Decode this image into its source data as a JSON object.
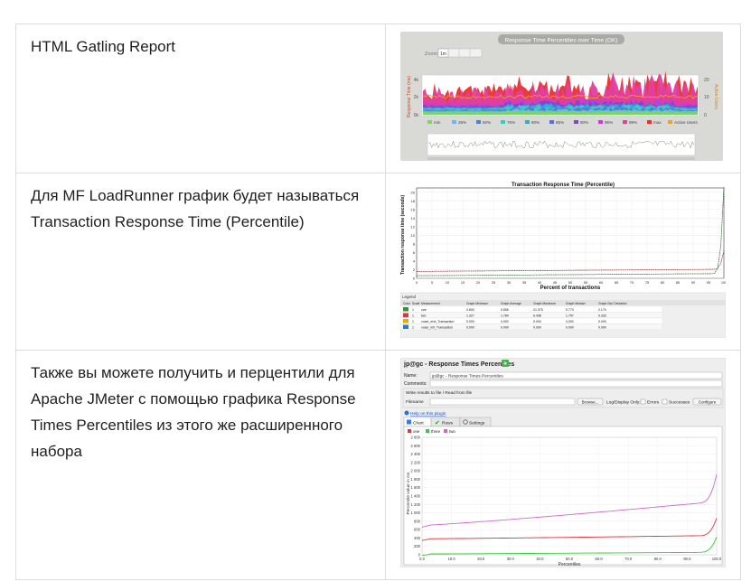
{
  "rows": [
    {
      "text": "HTML Gatling Report",
      "figure": {
        "title": "Response Time Percentiles over Time (OK)",
        "zoom_label": "Zoom",
        "zoom_options": [
          "1m"
        ],
        "y_left_label": "Response Time (ms)",
        "y_right_label": "Active Users",
        "y_left_ticks": [
          "4k",
          "2k",
          "0k"
        ],
        "y_right_ticks": [
          "20",
          "10",
          "0"
        ],
        "legend": [
          "min",
          "25%",
          "50%",
          "75%",
          "80%",
          "85%",
          "90%",
          "95%",
          "99%",
          "max",
          "Active Users"
        ],
        "colors": [
          "#7cd65e",
          "#6fb8e8",
          "#4f7fd1",
          "#3dc9c2",
          "#2ab0d8",
          "#5f6bd6",
          "#8a3fd1",
          "#c23fd0",
          "#e03fa0",
          "#e8322f",
          "#f2a31b"
        ]
      }
    },
    {
      "text": "Для MF LoadRunner график будет называться Transaction Response Time (Percentile)",
      "figure": {
        "title": "Transaction Response Time (Percentile)",
        "ylabel": "Transaction response time (seconds)",
        "xlabel": "Percent of transactions",
        "legend_title": "Legend",
        "legend_headers": [
          "Color",
          "Scale",
          "Measurement",
          "Graph Minimum",
          "Graph Average",
          "Graph Maximum",
          "Graph Median",
          "Graph Std. Deviation"
        ],
        "legend_rows": [
          {
            "color": "#3b8e3b",
            "scale": "1",
            "measurement": "one",
            "min": "0.800",
            "avg": "0.856",
            "max": "21.375",
            "median": "0.773",
            "std": "2.170"
          },
          {
            "color": "#d9363e",
            "scale": "1",
            "measurement": "two",
            "min": "1.327",
            "avg": "1.784",
            "max": "6.438",
            "median": "1.757",
            "std": "0.333"
          },
          {
            "color": "#e0b000",
            "scale": "1",
            "measurement": "vuser_end_Transaction",
            "min": "0.000",
            "avg": "0.000",
            "max": "0.000",
            "median": "0.000",
            "std": "0.000"
          },
          {
            "color": "#2a7bbf",
            "scale": "1",
            "measurement": "vuser_init_Transaction",
            "min": "0.000",
            "avg": "0.000",
            "max": "0.000",
            "median": "0.000",
            "std": "0.000"
          }
        ]
      }
    },
    {
      "text": "Также вы можете получить и перцентили для Apache JMeter с помощью графика Response Times Percentiles из этого же расширенного набора",
      "figure": {
        "window_title": "jp@gc - Response Times Percentiles",
        "name_label": "Name:",
        "name_value": "jp@gc - Response Times Percentiles",
        "comments_label": "Comments:",
        "write_label": "Write results to file / Read from file",
        "filename_label": "Filename",
        "browse_label": "Browse...",
        "log_label": "Log/Display Only:",
        "errors_label": "Errors",
        "successes_label": "Successes",
        "configure_label": "Configure",
        "help_label": "Help on this plugin",
        "tabs": [
          "Chart",
          "Rows",
          "Settings"
        ],
        "series": [
          {
            "name": "one",
            "color": "#d9363e"
          },
          {
            "name": "three",
            "color": "#3cc83c"
          },
          {
            "name": "two",
            "color": "#d066c8"
          }
        ],
        "y_ticks": [
          "2 800",
          "2 600",
          "2 400",
          "2 200",
          "2 000",
          "1 800",
          "1 600",
          "1 400",
          "1 200",
          "1 000",
          "800",
          "600",
          "400",
          "200",
          "0"
        ],
        "x_ticks": [
          "0.0",
          "10.0",
          "20.0",
          "30.0",
          "40.0",
          "50.0",
          "60.0",
          "70.0",
          "80.0",
          "90.0",
          "100.0"
        ],
        "ylabel": "Percentile value in ms",
        "xlabel": "Percentiles"
      }
    }
  ]
}
